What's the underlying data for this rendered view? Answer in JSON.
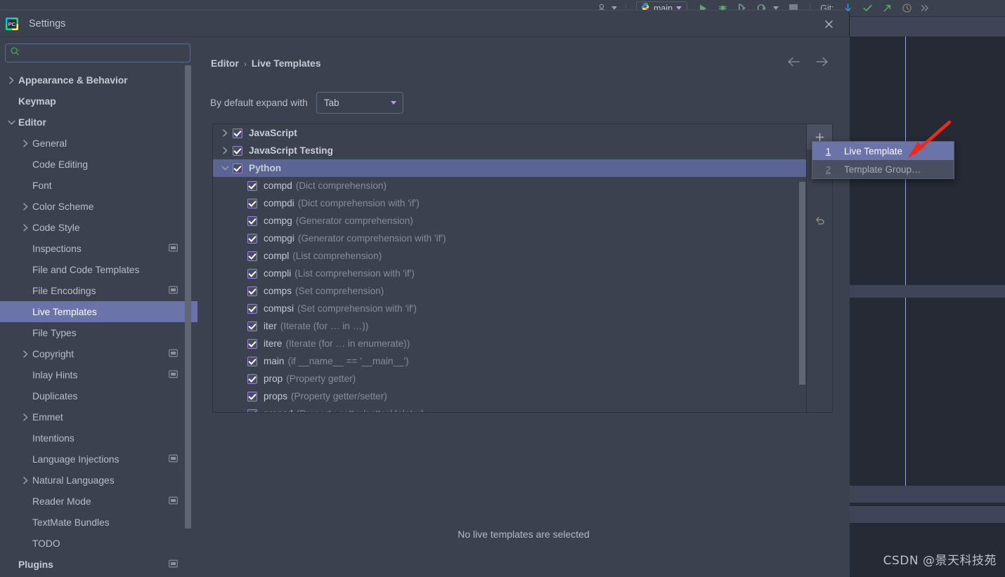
{
  "ide": {
    "toolbar": {
      "profile_icon": "user-icon",
      "run_config_label": "main",
      "run_config_icon": "python-icon",
      "run_icon": "run-icon",
      "debug_icon": "debug-icon",
      "run_coverage_icon": "run-with-coverage-icon",
      "profile_run_icon": "profile-icon",
      "stop_icon": "stop-icon",
      "git_label": "Git:",
      "git_update_icon": "git-update-icon",
      "git_commit_icon": "git-commit-icon",
      "git_push_icon": "git-push-icon",
      "git_history_icon": "git-history-icon"
    },
    "watermark": "CSDN @景天科技苑"
  },
  "dialog": {
    "title": "Settings",
    "logo_icon": "pycharm-logo-icon",
    "close_icon": "close-icon",
    "search": {
      "placeholder": "",
      "value": "",
      "icon": "search-icon"
    },
    "nav": {
      "back_icon": "arrow-left-icon",
      "forward_icon": "arrow-right-icon"
    }
  },
  "sidebar": {
    "items": [
      {
        "label": "Appearance & Behavior",
        "indent": 0,
        "arrow": "chevron-right",
        "bold": true,
        "selected": false,
        "badge": false
      },
      {
        "label": "Keymap",
        "indent": 0,
        "arrow": "none",
        "bold": true,
        "selected": false,
        "badge": false
      },
      {
        "label": "Editor",
        "indent": 0,
        "arrow": "chevron-down",
        "bold": true,
        "selected": false,
        "badge": false
      },
      {
        "label": "General",
        "indent": 1,
        "arrow": "chevron-right",
        "bold": false,
        "selected": false,
        "badge": false
      },
      {
        "label": "Code Editing",
        "indent": 1,
        "arrow": "none",
        "bold": false,
        "selected": false,
        "badge": false
      },
      {
        "label": "Font",
        "indent": 1,
        "arrow": "none",
        "bold": false,
        "selected": false,
        "badge": false
      },
      {
        "label": "Color Scheme",
        "indent": 1,
        "arrow": "chevron-right",
        "bold": false,
        "selected": false,
        "badge": false
      },
      {
        "label": "Code Style",
        "indent": 1,
        "arrow": "chevron-right",
        "bold": false,
        "selected": false,
        "badge": false
      },
      {
        "label": "Inspections",
        "indent": 1,
        "arrow": "none",
        "bold": false,
        "selected": false,
        "badge": true
      },
      {
        "label": "File and Code Templates",
        "indent": 1,
        "arrow": "none",
        "bold": false,
        "selected": false,
        "badge": false
      },
      {
        "label": "File Encodings",
        "indent": 1,
        "arrow": "none",
        "bold": false,
        "selected": false,
        "badge": true
      },
      {
        "label": "Live Templates",
        "indent": 1,
        "arrow": "none",
        "bold": false,
        "selected": true,
        "badge": false
      },
      {
        "label": "File Types",
        "indent": 1,
        "arrow": "none",
        "bold": false,
        "selected": false,
        "badge": false
      },
      {
        "label": "Copyright",
        "indent": 1,
        "arrow": "chevron-right",
        "bold": false,
        "selected": false,
        "badge": true
      },
      {
        "label": "Inlay Hints",
        "indent": 1,
        "arrow": "none",
        "bold": false,
        "selected": false,
        "badge": true
      },
      {
        "label": "Duplicates",
        "indent": 1,
        "arrow": "none",
        "bold": false,
        "selected": false,
        "badge": false
      },
      {
        "label": "Emmet",
        "indent": 1,
        "arrow": "chevron-right",
        "bold": false,
        "selected": false,
        "badge": false
      },
      {
        "label": "Intentions",
        "indent": 1,
        "arrow": "none",
        "bold": false,
        "selected": false,
        "badge": false
      },
      {
        "label": "Language Injections",
        "indent": 1,
        "arrow": "none",
        "bold": false,
        "selected": false,
        "badge": true
      },
      {
        "label": "Natural Languages",
        "indent": 1,
        "arrow": "chevron-right",
        "bold": false,
        "selected": false,
        "badge": false
      },
      {
        "label": "Reader Mode",
        "indent": 1,
        "arrow": "none",
        "bold": false,
        "selected": false,
        "badge": true
      },
      {
        "label": "TextMate Bundles",
        "indent": 1,
        "arrow": "none",
        "bold": false,
        "selected": false,
        "badge": false
      },
      {
        "label": "TODO",
        "indent": 1,
        "arrow": "none",
        "bold": false,
        "selected": false,
        "badge": false
      },
      {
        "label": "Plugins",
        "indent": 0,
        "arrow": "none",
        "bold": true,
        "selected": false,
        "badge": true
      }
    ]
  },
  "main": {
    "breadcrumb": {
      "parent": "Editor",
      "separator": "›",
      "current": "Live Templates"
    },
    "expand_with": {
      "label": "By default expand with",
      "value": "Tab"
    },
    "empty_message": "No live templates are selected",
    "toolbar": {
      "add_icon": "plus-icon",
      "add_dropdown_icon": "caret-down-icon",
      "revert_icon": "revert-icon"
    },
    "templates": [
      {
        "type": "group",
        "arrow": "chevron-right",
        "checked": true,
        "name": "JavaScript",
        "desc": "",
        "selected": false
      },
      {
        "type": "group",
        "arrow": "chevron-right",
        "checked": true,
        "name": "JavaScript Testing",
        "desc": "",
        "selected": false
      },
      {
        "type": "group",
        "arrow": "chevron-down",
        "checked": true,
        "name": "Python",
        "desc": "",
        "selected": true
      },
      {
        "type": "template",
        "arrow": "none",
        "checked": true,
        "name": "compd",
        "desc": "(Dict comprehension)",
        "selected": false
      },
      {
        "type": "template",
        "arrow": "none",
        "checked": true,
        "name": "compdi",
        "desc": "(Dict comprehension with 'if')",
        "selected": false
      },
      {
        "type": "template",
        "arrow": "none",
        "checked": true,
        "name": "compg",
        "desc": "(Generator comprehension)",
        "selected": false
      },
      {
        "type": "template",
        "arrow": "none",
        "checked": true,
        "name": "compgi",
        "desc": "(Generator comprehension with 'if')",
        "selected": false
      },
      {
        "type": "template",
        "arrow": "none",
        "checked": true,
        "name": "compl",
        "desc": "(List comprehension)",
        "selected": false
      },
      {
        "type": "template",
        "arrow": "none",
        "checked": true,
        "name": "compli",
        "desc": "(List comprehension with 'if')",
        "selected": false
      },
      {
        "type": "template",
        "arrow": "none",
        "checked": true,
        "name": "comps",
        "desc": "(Set comprehension)",
        "selected": false
      },
      {
        "type": "template",
        "arrow": "none",
        "checked": true,
        "name": "compsi",
        "desc": "(Set comprehension with 'if')",
        "selected": false
      },
      {
        "type": "template",
        "arrow": "none",
        "checked": true,
        "name": "iter",
        "desc": "(Iterate (for … in …))",
        "selected": false
      },
      {
        "type": "template",
        "arrow": "none",
        "checked": true,
        "name": "itere",
        "desc": "(Iterate (for … in enumerate))",
        "selected": false
      },
      {
        "type": "template",
        "arrow": "none",
        "checked": true,
        "name": "main",
        "desc": "(if __name__ == '__main__')",
        "selected": false
      },
      {
        "type": "template",
        "arrow": "none",
        "checked": true,
        "name": "prop",
        "desc": "(Property getter)",
        "selected": false
      },
      {
        "type": "template",
        "arrow": "none",
        "checked": true,
        "name": "props",
        "desc": "(Property getter/setter)",
        "selected": false
      },
      {
        "type": "template",
        "arrow": "none",
        "checked": true,
        "name": "propsd",
        "desc": "(Property getter/setter/deleter)",
        "selected": false
      }
    ]
  },
  "popup": {
    "items": [
      {
        "num": "1",
        "label": "Live Template",
        "selected": true
      },
      {
        "num": "2",
        "label": "Template Group…",
        "selected": false
      }
    ]
  },
  "colors": {
    "accent_selection": "#6a74a8",
    "tree_selection": "#5b6593",
    "panel_bg": "#3c4150",
    "editor_bg": "#262a35",
    "checkbox_border": "#9a7fd6",
    "annotation_arrow": "#f02a18"
  }
}
